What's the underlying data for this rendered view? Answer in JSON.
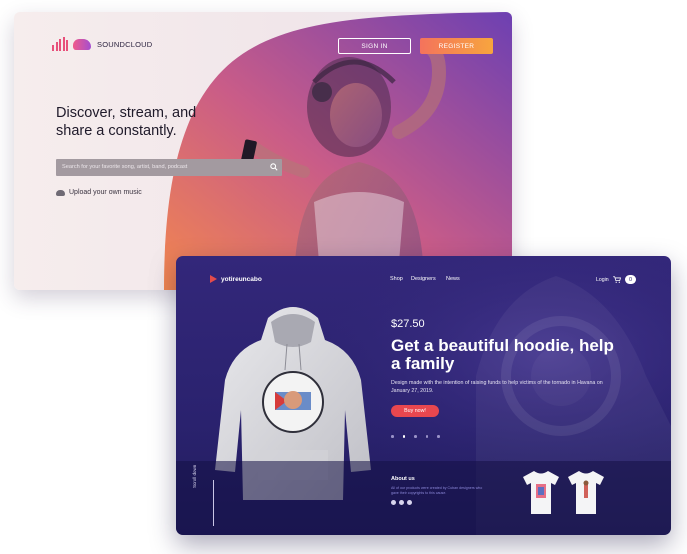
{
  "soundcloud": {
    "brand": "SOUNDCLOUD",
    "signin_label": "SIGN IN",
    "register_label": "REGISTER",
    "hero_text": "Discover, stream, and share a constantly.",
    "search_placeholder": "Search for your favorite  song, artist, band, podcast",
    "upload_label": "Upload your own music",
    "colors": {
      "accent": "#f4735c",
      "gradient_end": "#6a3fb0"
    }
  },
  "yotireuncabo": {
    "brand": "yotireuncabo",
    "nav": [
      "Shop",
      "Designers",
      "News"
    ],
    "login_label": "Login",
    "cart_count": "0",
    "price": "$27.50",
    "title": "Get a beautiful hoodie, help a family",
    "description": "Design made with the intention of raising funds to help victims of the tornado in Havana on January 27, 2019.",
    "buy_label": "Buy now!",
    "carousel_index": 2,
    "carousel_total": 5,
    "scroll_label": "Scroll down",
    "about_title": "About us",
    "about_text": "All of our products were created by Cuban designers who gave their copyrights to this cause.",
    "colors": {
      "background": "#2e2574",
      "buy_button": "#e8474f"
    }
  }
}
